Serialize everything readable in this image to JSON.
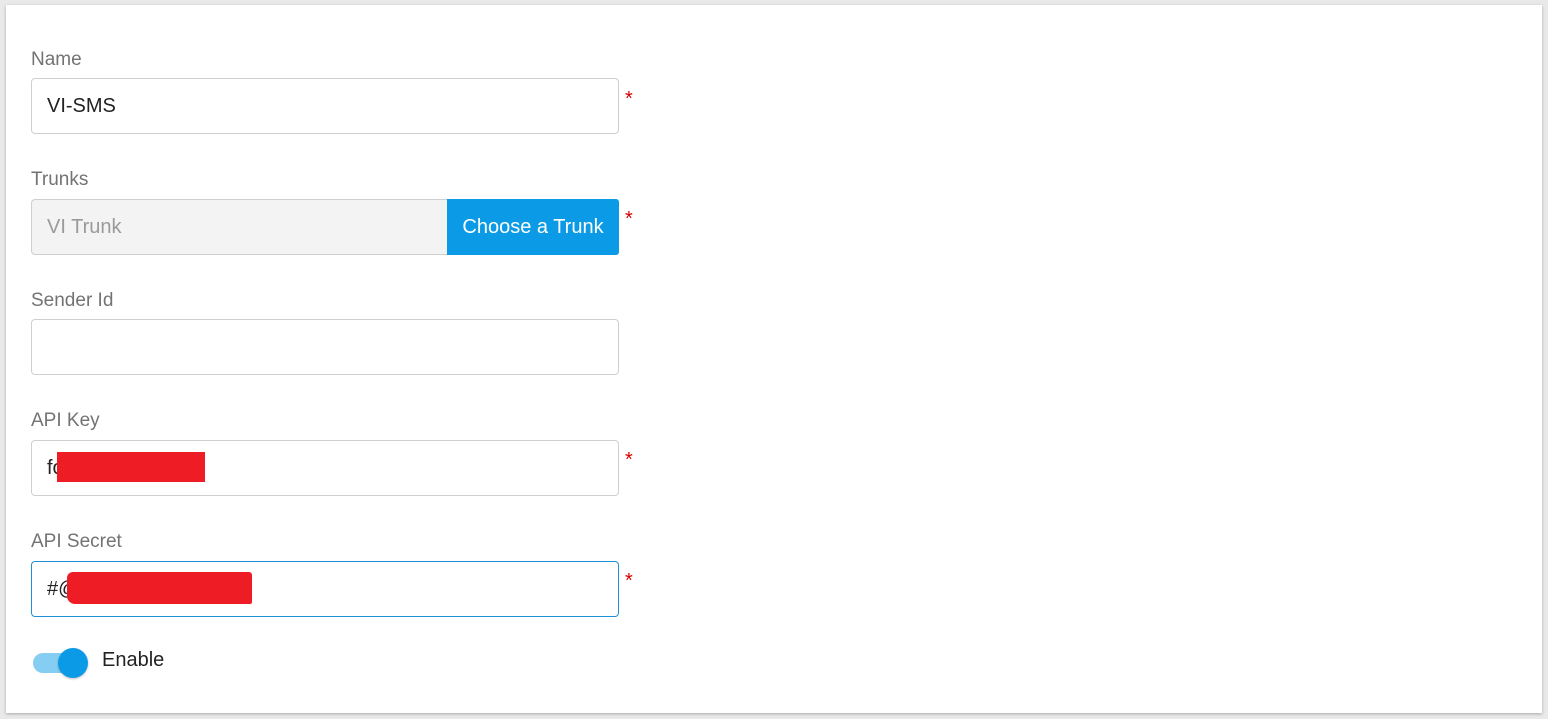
{
  "form": {
    "name": {
      "label": "Name",
      "value": "VI-SMS",
      "required": "*"
    },
    "trunks": {
      "label": "Trunks",
      "value": "VI Trunk",
      "button_label": "Choose a Trunk",
      "required": "*"
    },
    "sender_id": {
      "label": "Sender Id",
      "value": ""
    },
    "api_key": {
      "label": "API Key",
      "value_visible": "fo",
      "redacted": true,
      "required": "*"
    },
    "api_secret": {
      "label": "API Secret",
      "value_visible": "#@",
      "redacted": true,
      "required": "*"
    },
    "enable": {
      "label": "Enable",
      "checked": true
    }
  },
  "colors": {
    "accent": "#0b9be6",
    "toggle_track": "#85cdf2",
    "required": "#d40000",
    "redaction": "#ee1c25"
  }
}
